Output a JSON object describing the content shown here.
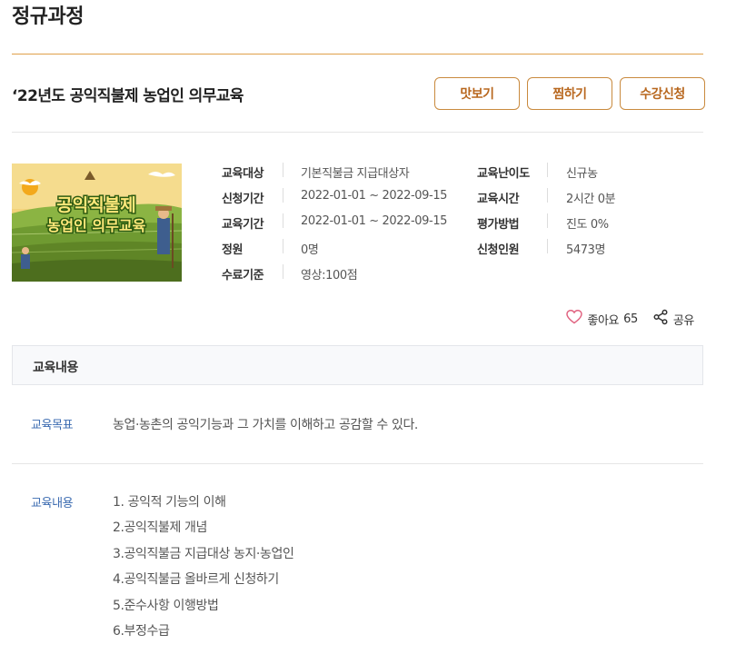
{
  "page": {
    "heading": "정규과정"
  },
  "course": {
    "title": "‘22년도 공익직불제 농업인 의무교육",
    "thumbnail_text_line1": "공익직불제",
    "thumbnail_text_line2": "농업인 의무교육"
  },
  "buttons": {
    "preview": "맛보기",
    "wishlist": "찜하기",
    "enroll": "수강신청"
  },
  "info": {
    "target_label": "교육대상",
    "target_value": "기본직불금 지급대상자",
    "difficulty_label": "교육난이도",
    "difficulty_value": "신규농",
    "apply_period_label": "신청기간",
    "apply_period_value": "2022-01-01 ~ 2022-09-15",
    "duration_label": "교육시간",
    "duration_value": "2시간 0분",
    "edu_period_label": "교육기간",
    "edu_period_value": "2022-01-01 ~ 2022-09-15",
    "eval_label": "평가방법",
    "eval_value": "진도 0%",
    "capacity_label": "정원",
    "capacity_value": "0명",
    "applicants_label": "신청인원",
    "applicants_value": "5473명",
    "completion_label": "수료기준",
    "completion_value": "영상:100점"
  },
  "actions": {
    "like_label": "좋아요",
    "like_count": "65",
    "share_label": "공유"
  },
  "section": {
    "title": "교육내용",
    "goal_label": "교육목표",
    "goal_text": "농업·농촌의 공익기능과 그 가치를 이해하고 공감할 수 있다.",
    "content_label": "교육내용",
    "content_items": [
      "1. 공익적 기능의 이해",
      "2.공익직불제 개념",
      "3.공익직불금 지급대상 농지·농업인",
      "4.공익직불금 올바르게 신청하기",
      "5.준수사항 이행방법",
      "6.부정수급"
    ]
  },
  "colors": {
    "accent": "#c98a3e",
    "label_blue": "#3a6ab0",
    "rule_orange": "#e0a04a"
  },
  "icons": {
    "like": "heart-icon",
    "share": "share-icon"
  }
}
